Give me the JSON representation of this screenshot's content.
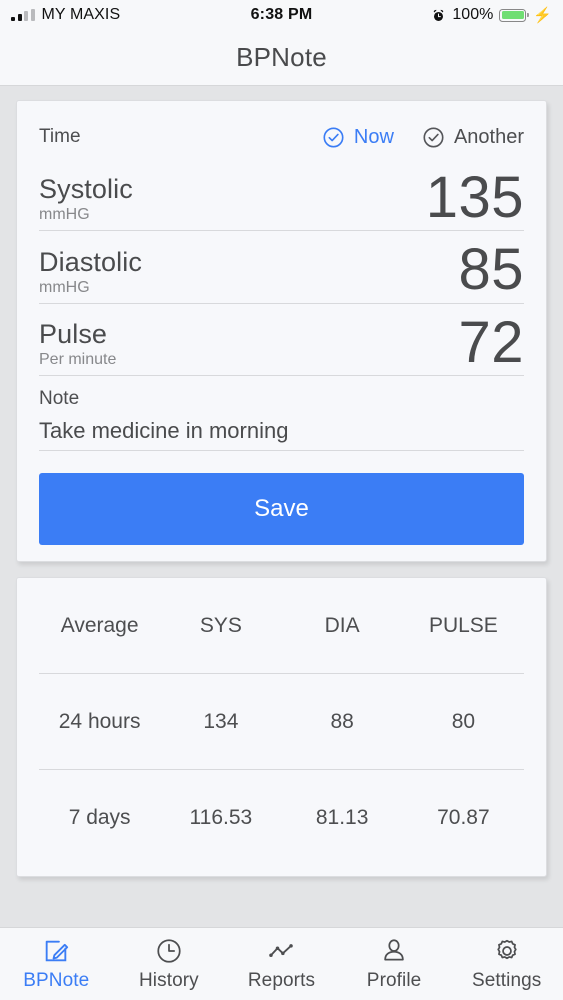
{
  "statusbar": {
    "carrier": "MY MAXIS",
    "time": "6:38 PM",
    "battery_percent": "100%",
    "alarm_icon": "alarm-clock-icon",
    "battery_icon": "battery-full-icon",
    "charging_icon": "lightning-bolt-icon",
    "signal_icon": "cellular-signal-icon"
  },
  "navbar": {
    "title": "BPNote"
  },
  "entry_card": {
    "time_label": "Time",
    "options": [
      {
        "label": "Now",
        "selected": true,
        "icon": "check-circle-icon"
      },
      {
        "label": "Another",
        "selected": false,
        "icon": "check-circle-icon"
      }
    ],
    "measurements": [
      {
        "name": "Systolic",
        "unit": "mmHG",
        "value": "135"
      },
      {
        "name": "Diastolic",
        "unit": "mmHG",
        "value": "85"
      },
      {
        "name": "Pulse",
        "unit": "Per minute",
        "value": "72"
      }
    ],
    "note_label": "Note",
    "note_value": "Take medicine in morning",
    "save_label": "Save"
  },
  "averages_table": {
    "headers": [
      "Average",
      "SYS",
      "DIA",
      "PULSE"
    ],
    "rows": [
      [
        "24 hours",
        "134",
        "88",
        "80"
      ],
      [
        "7 days",
        "116.53",
        "81.13",
        "70.87"
      ]
    ]
  },
  "tabbar": {
    "tabs": [
      {
        "label": "BPNote",
        "icon": "edit-note-icon",
        "active": true
      },
      {
        "label": "History",
        "icon": "clock-icon",
        "active": false
      },
      {
        "label": "Reports",
        "icon": "line-chart-icon",
        "active": false
      },
      {
        "label": "Profile",
        "icon": "person-icon",
        "active": false
      },
      {
        "label": "Settings",
        "icon": "gear-icon",
        "active": false
      }
    ]
  },
  "colors": {
    "accent": "#3b7df5",
    "page_bg": "#e3e4e6",
    "card_bg": "#f7f8fb",
    "text": "#4a4b4d",
    "muted": "#87888b",
    "battery_green": "#6fde73"
  }
}
